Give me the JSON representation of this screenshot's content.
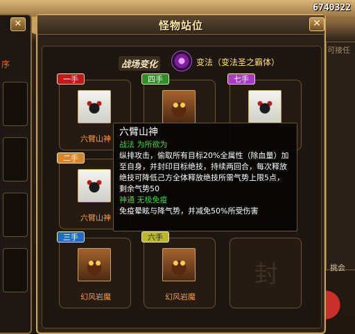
{
  "background": {
    "gold": "6740322",
    "left_text": "序",
    "right_text": "可接任",
    "right_text2": "挑会"
  },
  "dialog": {
    "title": "怪物站位",
    "close_label": "✕"
  },
  "field_change": {
    "label": "战场变化",
    "effect": "变法（变法圣之霸体）"
  },
  "slots": [
    {
      "badge": "一手",
      "name": "六臂山神",
      "type": "white",
      "color": "red"
    },
    {
      "badge": "四手",
      "name": "",
      "type": "brown",
      "color": "green"
    },
    {
      "badge": "七手",
      "name": "",
      "type": "white",
      "color": "purple"
    },
    {
      "badge": "二手",
      "name": "六臂山神",
      "type": "white",
      "color": "orange"
    },
    {
      "badge": "三手",
      "name": "幻风岩魔",
      "type": "brown",
      "color": "blue"
    },
    {
      "badge": "六手",
      "name": "幻风岩魔",
      "type": "brown",
      "color": "yellow"
    },
    {
      "seal": "封"
    }
  ],
  "tooltip": {
    "title": "六臂山神",
    "skill1_name": "战法 为所欲为",
    "skill1_desc": "纵排攻击，偷取所有目标20%全属性（除血量）加至自身，并封印目标绝技，持续两回合，每次释放绝技可降低己方全体释放绝技所需气势上限5点，剩余气势50",
    "skill2_name": "神通 无极免疫",
    "skill2_desc": "免疫晕眩与降气势，并减免50%所受伤害"
  }
}
